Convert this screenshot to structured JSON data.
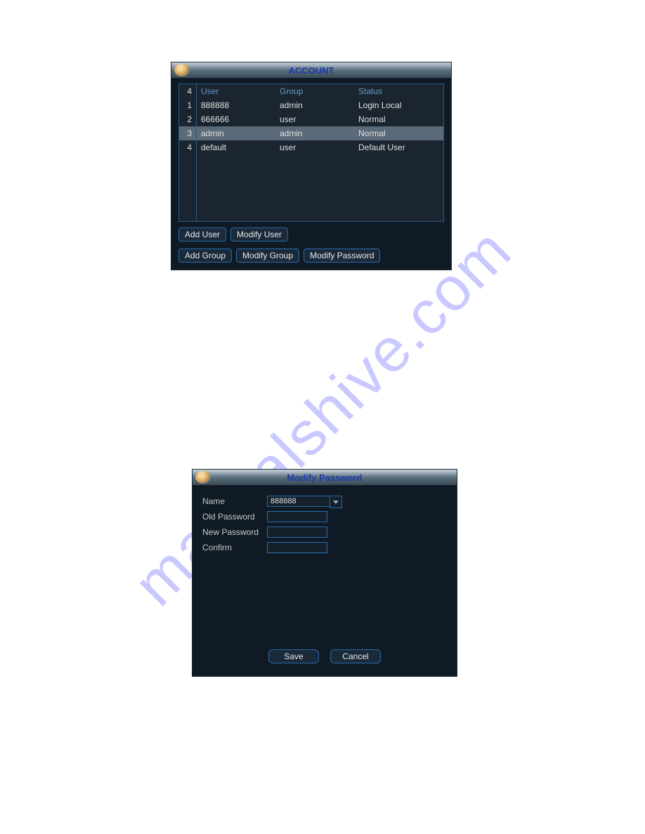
{
  "watermark": "manualshive.com",
  "account": {
    "title": "ACCOUNT",
    "count_header": "4",
    "columns": {
      "user": "User",
      "group": "Group",
      "status": "Status"
    },
    "rows": [
      {
        "n": "1",
        "user": "888888",
        "group": "admin",
        "status": "Login Local",
        "selected": false
      },
      {
        "n": "2",
        "user": "666666",
        "group": "user",
        "status": "Normal",
        "selected": false
      },
      {
        "n": "3",
        "user": "admin",
        "group": "admin",
        "status": "Normal",
        "selected": true
      },
      {
        "n": "4",
        "user": "default",
        "group": "user",
        "status": "Default User",
        "selected": false
      }
    ],
    "buttons": {
      "add_user": "Add User",
      "modify_user": "Modify User",
      "add_group": "Add Group",
      "modify_group": "Modify Group",
      "modify_password": "Modify Password"
    }
  },
  "modify_password": {
    "title": "Modify Password",
    "labels": {
      "name": "Name",
      "old_pw": "Old Password",
      "new_pw": "New Password",
      "confirm": "Confirm"
    },
    "name_value": "888888",
    "buttons": {
      "save": "Save",
      "cancel": "Cancel"
    }
  }
}
